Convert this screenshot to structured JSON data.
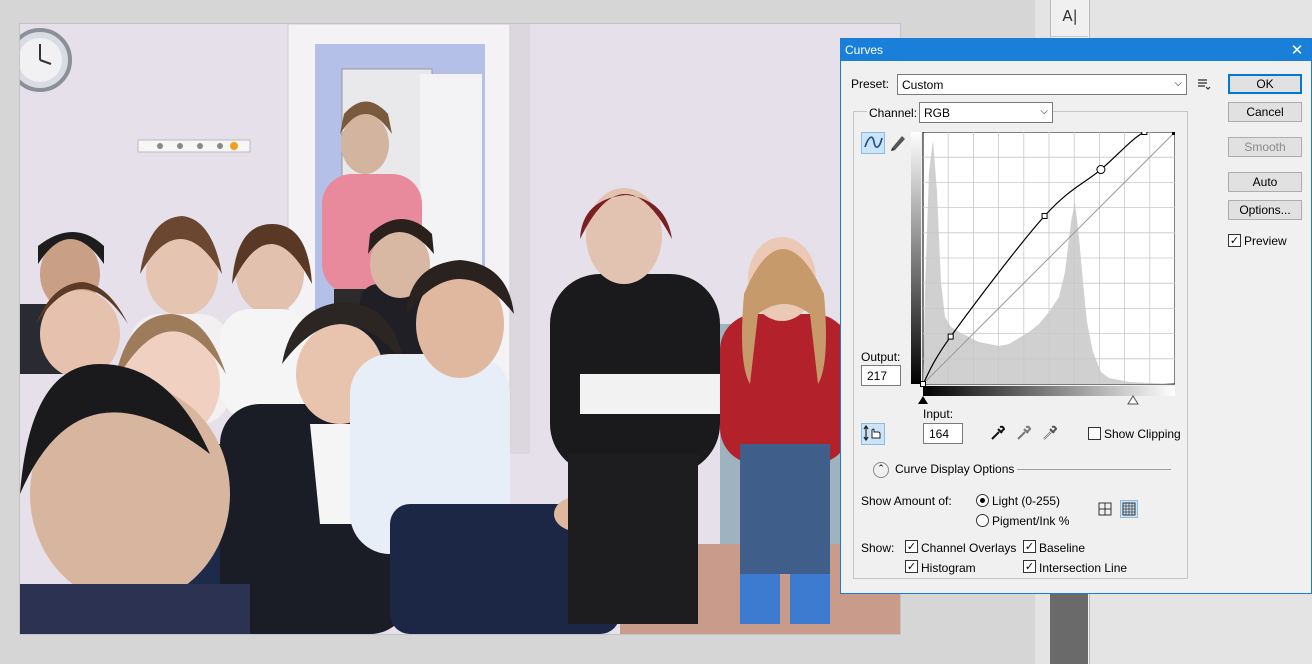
{
  "workspace": {
    "panel_tool_icon": "type-tool-icon"
  },
  "dialog": {
    "title": "Curves",
    "preset": {
      "label": "Preset:",
      "value": "Custom"
    },
    "channel": {
      "label": "Channel:",
      "value": "RGB"
    },
    "buttons": {
      "ok": "OK",
      "cancel": "Cancel",
      "smooth": "Smooth",
      "auto": "Auto",
      "options": "Options..."
    },
    "preview": {
      "label": "Preview",
      "checked": true
    },
    "output": {
      "label": "Output:",
      "value": "217"
    },
    "input": {
      "label": "Input:",
      "value": "164"
    },
    "show_clipping": {
      "label": "Show Clipping",
      "checked": false
    },
    "curve_display_options": "Curve Display Options",
    "show_amount": {
      "label": "Show Amount of:",
      "light": "Light  (0-255)",
      "pigment": "Pigment/Ink %",
      "selected": "light"
    },
    "show": {
      "label": "Show:",
      "channel_overlays": {
        "label": "Channel Overlays",
        "checked": true
      },
      "baseline": {
        "label": "Baseline",
        "checked": true
      },
      "histogram": {
        "label": "Histogram",
        "checked": true
      },
      "intersection_line": {
        "label": "Intersection Line",
        "checked": true
      }
    },
    "curve_points": [
      [
        0,
        0
      ],
      [
        28,
        48
      ],
      [
        123,
        170
      ],
      [
        180,
        217
      ],
      [
        224,
        255
      ],
      [
        255,
        255
      ]
    ],
    "selected_point_index": 3,
    "colors": {
      "title_bar": "#1a7fd8",
      "accent": "#0078d7",
      "histogram": "#d0d0d0"
    }
  }
}
